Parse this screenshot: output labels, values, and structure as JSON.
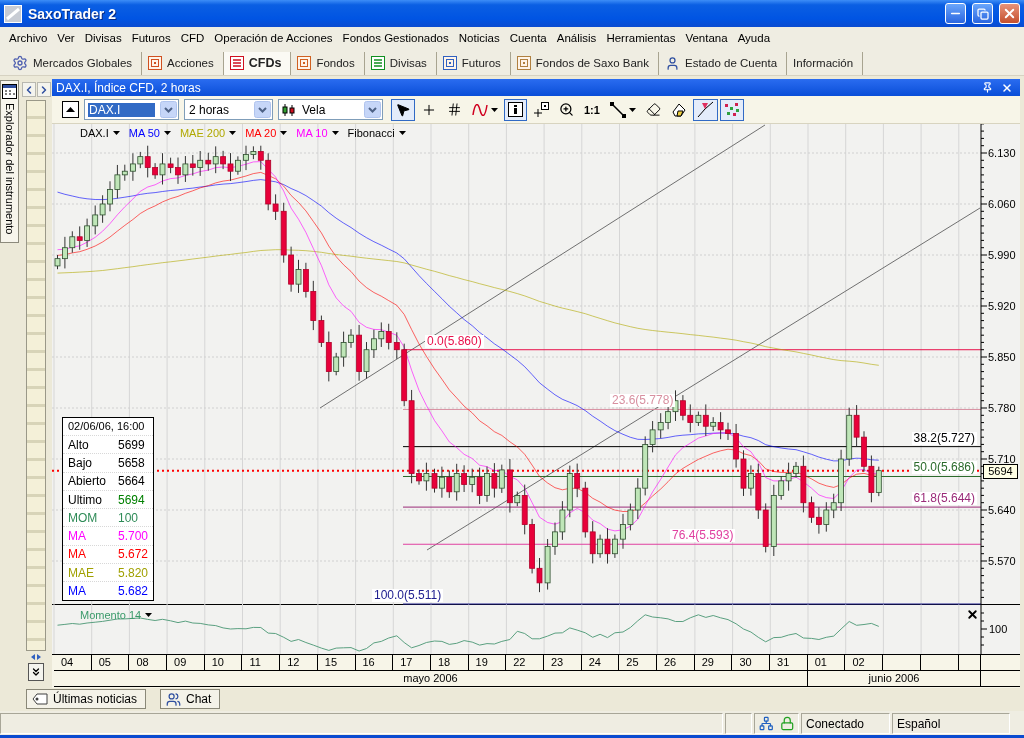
{
  "window": {
    "title": "SaxoTrader 2"
  },
  "menu": [
    "Archivo",
    "Ver",
    "Divisas",
    "Futuros",
    "CFD",
    "Operación de Acciones",
    "Fondos Gestionados",
    "Noticias",
    "Cuenta",
    "Análisis",
    "Herramientas",
    "Ventana",
    "Ayuda"
  ],
  "tabs": [
    {
      "label": "Mercados Globales",
      "selected": false
    },
    {
      "label": "Acciones",
      "selected": false
    },
    {
      "label": "CFDs",
      "selected": true
    },
    {
      "label": "Fondos",
      "selected": false
    },
    {
      "label": "Divisas",
      "selected": false
    },
    {
      "label": "Futuros",
      "selected": false
    },
    {
      "label": "Fondos de Saxo Bank",
      "selected": false
    },
    {
      "label": "Estado de Cuenta",
      "selected": false
    },
    {
      "label": "Información",
      "selected": false
    }
  ],
  "side_panel": {
    "title": "Explorador del instrumento"
  },
  "chart": {
    "title": "DAX.I, Índice CFD, 2 horas",
    "selectors": [
      {
        "value": "DAX.I",
        "text_selected": true
      },
      {
        "value": "2 horas",
        "text_selected": false
      },
      {
        "value": "Vela",
        "text_selected": false
      }
    ],
    "tools": [
      {
        "selected": true,
        "dropdown": false
      },
      {
        "selected": false,
        "dropdown": false
      },
      {
        "selected": false,
        "dropdown": false
      },
      {
        "selected": false,
        "dropdown": true
      },
      {
        "selected": true,
        "dropdown": false
      },
      {
        "selected": false,
        "dropdown": false
      },
      {
        "selected": false,
        "dropdown": false
      },
      {
        "label": "1:1",
        "selected": false,
        "dropdown": false
      },
      {
        "selected": false,
        "dropdown": true
      },
      {
        "selected": false,
        "dropdown": false
      },
      {
        "selected": false,
        "dropdown": false
      },
      {
        "selected": true,
        "dropdown": false
      },
      {
        "selected": true,
        "dropdown": false
      }
    ],
    "legend": [
      {
        "label": "DAX.I",
        "color": "#000000"
      },
      {
        "label": "MA 50",
        "color": "#0000ff"
      },
      {
        "label": "MAE 200",
        "color": "#b0a800"
      },
      {
        "label": "MA 20",
        "color": "#ff0000"
      },
      {
        "label": "MA 10",
        "color": "#ff00ff"
      },
      {
        "label": "Fibonacci",
        "color": "#000000"
      }
    ],
    "price_axis": [
      "6.130",
      "6.060",
      "5.990",
      "5.920",
      "5.850",
      "5.780",
      "5.710",
      "5.640",
      "5.570"
    ],
    "last_price": "5694",
    "fibonacci": [
      {
        "label": "0.0(5.860)",
        "color": "#e8104a"
      },
      {
        "label": "23.6(5.778)",
        "color": "#d890a0"
      },
      {
        "label": "38.2(5.727)",
        "color": "#000000"
      },
      {
        "label": "50.0(5.686)",
        "color": "#2a6a2a"
      },
      {
        "label": "61.8(5.644)",
        "color": "#9a2a78"
      },
      {
        "label": "76.4(5.593)",
        "color": "#e040a0"
      },
      {
        "label": "100.0(5.511)",
        "color": "#202090"
      }
    ],
    "info_box": {
      "title": "02/06/06, 16:00",
      "rows": [
        {
          "label": {
            "text": "Alto",
            "color": "#000000"
          },
          "value": {
            "text": "5699",
            "color": "#000000"
          }
        },
        {
          "label": {
            "text": "Bajo",
            "color": "#000000"
          },
          "value": {
            "text": "5658",
            "color": "#000000"
          }
        },
        {
          "label": {
            "text": "Abierto",
            "color": "#000000"
          },
          "value": {
            "text": "5664",
            "color": "#000000"
          }
        },
        {
          "label": {
            "text": "Ultimo",
            "color": "#000000"
          },
          "value": {
            "text": "5694",
            "color": "#008000"
          }
        },
        {
          "label": {
            "text": "MOM",
            "color": "#2e8b57"
          },
          "value": {
            "text": "100",
            "color": "#2e8b57"
          }
        },
        {
          "label": {
            "text": "MA",
            "color": "#ff00ff"
          },
          "value": {
            "text": "5.700",
            "color": "#ff00ff"
          }
        },
        {
          "label": {
            "text": "MA",
            "color": "#ff0000"
          },
          "value": {
            "text": "5.672",
            "color": "#ff0000"
          }
        },
        {
          "label": {
            "text": "MAE",
            "color": "#a0a000"
          },
          "value": {
            "text": "5.820",
            "color": "#a0a000"
          }
        },
        {
          "label": {
            "text": "MA",
            "color": "#0000ff"
          },
          "value": {
            "text": "5.682",
            "color": "#0000ff"
          }
        }
      ]
    },
    "momentum": {
      "label": "Momento 14",
      "axis_label": "100"
    },
    "date_axis": {
      "months": [
        {
          "label": "mayo 2006",
          "days": [
            "04",
            "05",
            "08",
            "09",
            "10",
            "11",
            "12",
            "15",
            "16",
            "17",
            "18",
            "19",
            "22",
            "23",
            "24",
            "25",
            "26",
            "29",
            "30",
            "31"
          ]
        },
        {
          "label": "junio 2006",
          "days": [
            "01",
            "02"
          ]
        }
      ]
    }
  },
  "bottom_tabs": [
    "Últimas noticias",
    "Chat"
  ],
  "status_bar": {
    "connection": "Conectado",
    "language": "Español"
  }
}
